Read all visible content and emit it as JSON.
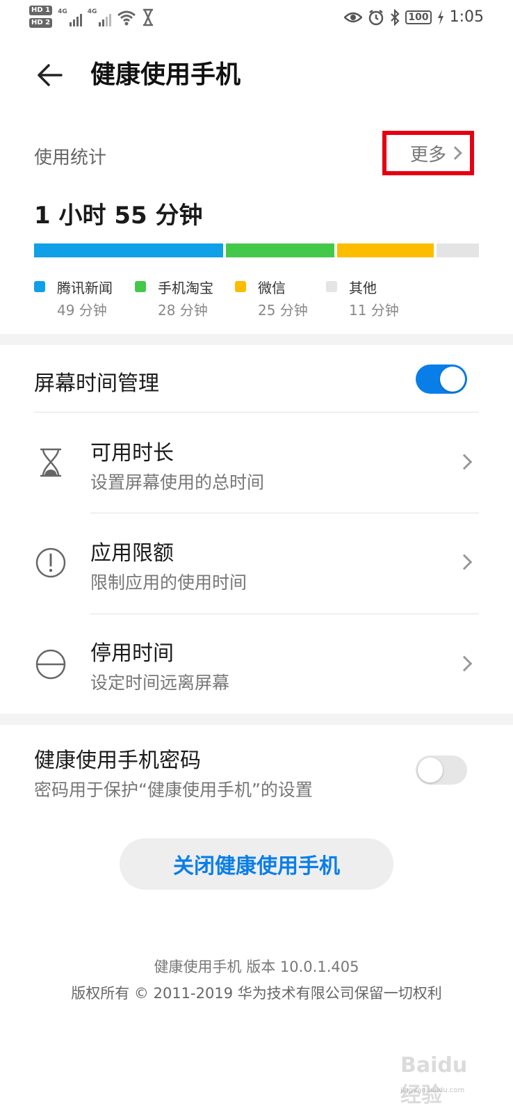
{
  "status_bar": {
    "hd1": "HD 1",
    "hd2": "HD 2",
    "net1": "4G",
    "net2": "4G",
    "battery": "100",
    "time": "1:05"
  },
  "header": {
    "title": "健康使用手机"
  },
  "usage": {
    "label": "使用统计",
    "more": "更多",
    "total": "1 小时 55 分钟",
    "apps": [
      {
        "name": "腾讯新闻",
        "time": "49 分钟",
        "minutes": 49,
        "color": "#0fa0e8"
      },
      {
        "name": "手机淘宝",
        "time": "28 分钟",
        "minutes": 28,
        "color": "#44c84a"
      },
      {
        "name": "微信",
        "time": "25 分钟",
        "minutes": 25,
        "color": "#fcbc00"
      },
      {
        "name": "其他",
        "time": "11 分钟",
        "minutes": 11,
        "color": "#e4e4e4"
      }
    ]
  },
  "screen_time": {
    "title": "屏幕时间管理",
    "enabled": true,
    "items": [
      {
        "title": "可用时长",
        "subtitle": "设置屏幕使用的总时间",
        "icon": "hourglass-icon"
      },
      {
        "title": "应用限额",
        "subtitle": "限制应用的使用时间",
        "icon": "exclamation-circle-icon"
      },
      {
        "title": "停用时间",
        "subtitle": "设定时间远离屏幕",
        "icon": "minus-circle-icon"
      }
    ]
  },
  "password": {
    "title": "健康使用手机密码",
    "subtitle": "密码用于保护“健康使用手机”的设置",
    "enabled": false
  },
  "close_button": "关闭健康使用手机",
  "footer": {
    "version": "健康使用手机 版本 10.0.1.405",
    "copyright": "版权所有 © 2011-2019 华为技术有限公司保留一切权利"
  },
  "watermark": {
    "text": "Baidu经验",
    "url": "jingyan.baidu.com"
  }
}
